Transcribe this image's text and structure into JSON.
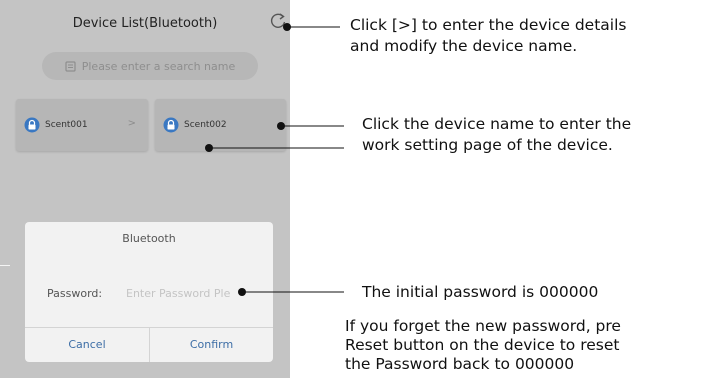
{
  "screen": {
    "title": "Device List(Bluetooth)",
    "refresh_icon": "refresh-icon",
    "search": {
      "placeholder": "Please enter a search name",
      "icon": "search-icon"
    },
    "devices": [
      {
        "name": "Scent001",
        "chevron": ">",
        "icon": "lock-icon"
      },
      {
        "name": "Scent002",
        "icon": "lock-icon"
      }
    ]
  },
  "dialog": {
    "title": "Bluetooth",
    "password_label": "Password:",
    "password_placeholder": "Enter Password Ple",
    "cancel": "Cancel",
    "confirm": "Confirm"
  },
  "annotations": {
    "refresh_note": [
      "Click [>] to enter the device details",
      "and modify the device name."
    ],
    "device_note": [
      "Click the device name to enter the",
      "work setting page of the device."
    ],
    "password_note": "The initial password is 000000",
    "reset_note": [
      "If you forget the new password, pre",
      "Reset button on the device to reset",
      "the Password back to 000000"
    ]
  },
  "colors": {
    "phone_bg": "#c4c4c4",
    "card_bg": "#b6b6b6",
    "dialog_bg": "#f2f2f2",
    "dialog_button": "#3d6ea6",
    "icon_blue": "#3a78c2"
  }
}
